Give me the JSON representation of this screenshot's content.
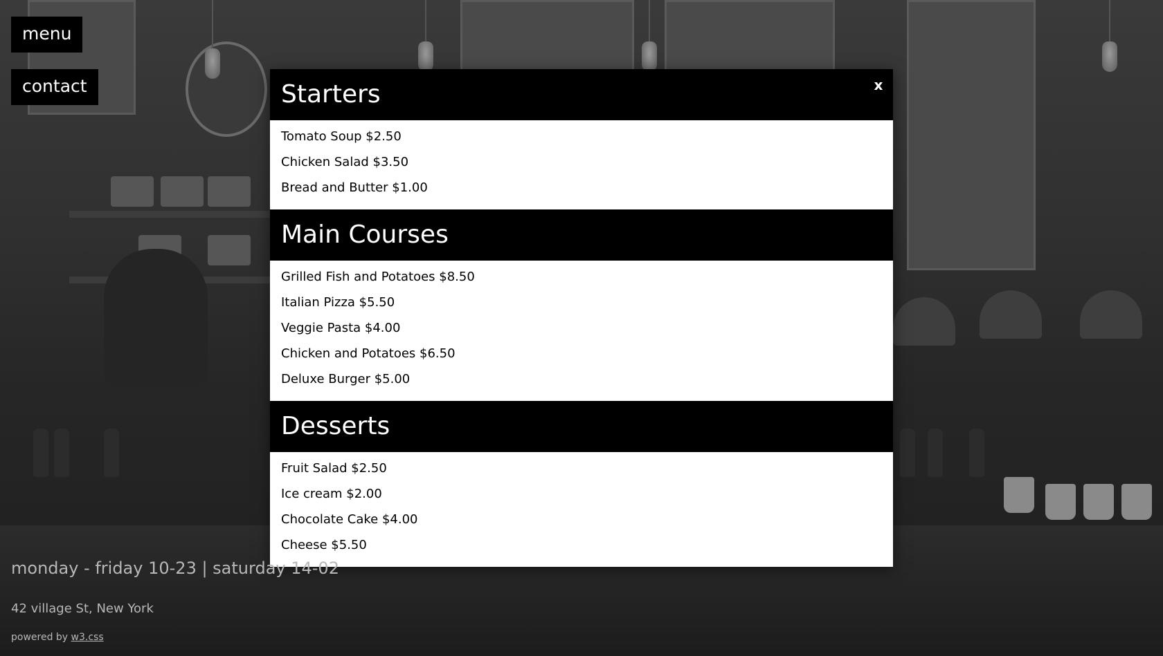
{
  "nav": {
    "menu_label": "menu",
    "contact_label": "contact"
  },
  "modal": {
    "close_label": "x",
    "sections": [
      {
        "title": "Starters",
        "items": [
          "Tomato Soup $2.50",
          "Chicken Salad $3.50",
          "Bread and Butter $1.00"
        ]
      },
      {
        "title": "Main Courses",
        "items": [
          "Grilled Fish and Potatoes $8.50",
          "Italian Pizza $5.50",
          "Veggie Pasta $4.00",
          "Chicken and Potatoes $6.50",
          "Deluxe Burger $5.00"
        ]
      },
      {
        "title": "Desserts",
        "items": [
          "Fruit Salad $2.50",
          "Ice cream $2.00",
          "Chocolate Cake $4.00",
          "Cheese $5.50"
        ]
      }
    ]
  },
  "footer": {
    "hours": "monday - friday 10-23 | saturday 14-02",
    "address": "42 village St, New York",
    "powered_prefix": "powered by",
    "powered_link": "w3.css"
  },
  "colors": {
    "panel": "#000000",
    "modal_body": "#ffffff",
    "footer_text": "#b8b8b8"
  }
}
